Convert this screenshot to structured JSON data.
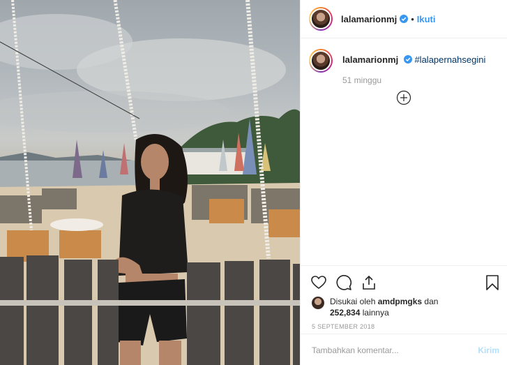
{
  "post": {
    "username": "lalamarionmj",
    "follow_label": "Ikuti",
    "dot": "•",
    "caption_username": "lalamarionmj",
    "caption_text": "#lalapernahsegini",
    "time_ago": "51 minggu",
    "liked_by_prefix": "Disukai oleh",
    "liked_by_user": "amdpmgks",
    "liked_by_and": "dan",
    "likes_count": "252,834",
    "likes_suffix": "lainnya",
    "date": "5 SEPTEMBER 2018",
    "comment_placeholder": "Tambahkan komentar...",
    "post_button": "Kirim"
  },
  "icons": {
    "like": "heart-icon",
    "comment": "comment-icon",
    "share": "share-icon",
    "save": "bookmark-icon",
    "load_more": "plus-circle-icon",
    "verified": "verified-badge-icon"
  },
  "colors": {
    "link_blue": "#3897f0",
    "hashtag": "#003569",
    "muted": "#999999",
    "border": "#efefef",
    "post_disabled": "#b2dffc"
  }
}
